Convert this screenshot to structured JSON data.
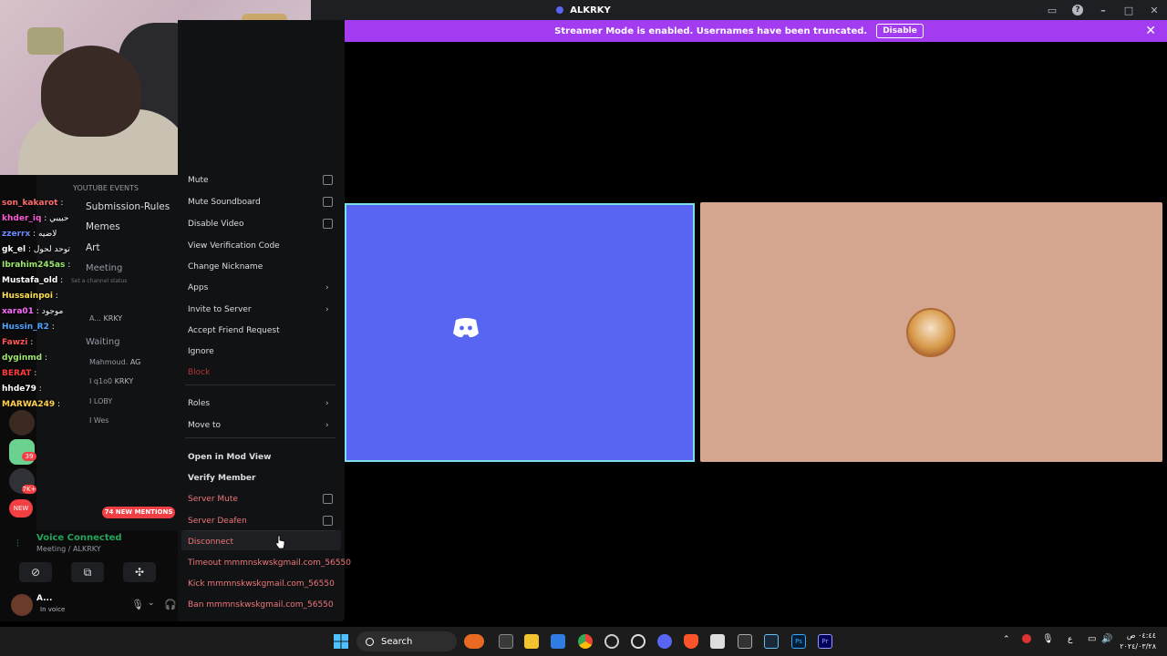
{
  "window": {
    "title": "ALKRKY"
  },
  "banner": {
    "text": "Streamer Mode is enabled. Usernames have been truncated.",
    "disable_label": "Disable"
  },
  "channels": {
    "category": "YOUTUBE EVENTS",
    "items": [
      {
        "label": "Submission-Rules"
      },
      {
        "label": "Memes"
      },
      {
        "label": "Art"
      }
    ],
    "voice_channels": [
      {
        "label": "Meeting"
      },
      {
        "label": "Waiting"
      }
    ],
    "channel_status_placeholder": "Set a channel status",
    "members": [
      {
        "name": "A...",
        "tag": "KRKY"
      },
      {
        "name": "Mahmoud.",
        "tag": "AG"
      },
      {
        "name": "I q1o0",
        "tag": "KRKY"
      },
      {
        "name": "I LOBY",
        "tag": ""
      },
      {
        "name": "I Wes",
        "tag": ""
      }
    ]
  },
  "server_badges": {
    "b1": "39",
    "b2": "7K+",
    "new_label": "NEW"
  },
  "mentions_pill": "74 NEW MENTIONS",
  "chat": [
    {
      "user": "son_kakarot",
      "color": "#ff6b6b",
      "msg": ""
    },
    {
      "user": "khder_iq",
      "color": "#ff5ad6",
      "msg": "حبيبي"
    },
    {
      "user": "zzerrx",
      "color": "#6b8cff",
      "msg": "لاضيه"
    },
    {
      "user": "gk_el",
      "color": "#ffffff",
      "msg": "توحد لحول"
    },
    {
      "user": "Ibrahim245as",
      "color": "#9fe870",
      "msg": ""
    },
    {
      "user": "Mustafa_old",
      "color": "#ffffff",
      "msg": ""
    },
    {
      "user": "Hussainpoi",
      "color": "#ffe14d",
      "msg": ""
    },
    {
      "user": "xara01",
      "color": "#ff6bff",
      "msg": "موجود"
    },
    {
      "user": "Hussin_R2",
      "color": "#4da3ff",
      "msg": ""
    },
    {
      "user": "Fawzi",
      "color": "#ff5555",
      "msg": ""
    },
    {
      "user": "dyginmd",
      "color": "#9fe870",
      "msg": ""
    },
    {
      "user": "BERAT",
      "color": "#ff3b3b",
      "msg": ""
    },
    {
      "user": "hhde79",
      "color": "#ffffff",
      "msg": ""
    },
    {
      "user": "MARWA249",
      "color": "#ffd24d",
      "msg": ""
    }
  ],
  "context_menu": {
    "items": [
      {
        "label": "Mute",
        "kind": "checkbox"
      },
      {
        "label": "Mute Soundboard",
        "kind": "checkbox"
      },
      {
        "label": "Disable Video",
        "kind": "checkbox"
      },
      {
        "label": "View Verification Code",
        "kind": "plain"
      },
      {
        "label": "Change Nickname",
        "kind": "plain"
      },
      {
        "label": "Apps",
        "kind": "submenu"
      },
      {
        "label": "Invite to Server",
        "kind": "submenu"
      },
      {
        "label": "Accept Friend Request",
        "kind": "plain"
      },
      {
        "label": "Ignore",
        "kind": "plain"
      },
      {
        "label": "Block",
        "kind": "danger"
      },
      {
        "label": "Roles",
        "kind": "submenu"
      },
      {
        "label": "Move to",
        "kind": "submenu"
      },
      {
        "label": "Open in Mod View",
        "kind": "bold"
      },
      {
        "label": "Verify Member",
        "kind": "bold"
      },
      {
        "label": "Server Mute",
        "kind": "danger-checkbox"
      },
      {
        "label": "Server Deafen",
        "kind": "danger-checkbox"
      },
      {
        "label": "Disconnect",
        "kind": "danger"
      },
      {
        "label": "Timeout mmmnskwskgmail.com_56550",
        "kind": "danger"
      },
      {
        "label": "Kick mmmnskwskgmail.com_56550",
        "kind": "danger"
      },
      {
        "label": "Ban mmmnskwskgmail.com_56550",
        "kind": "danger"
      }
    ]
  },
  "voice": {
    "status": "Voice Connected",
    "location": "Meeting / ALKRKY"
  },
  "user_panel": {
    "name": "A...",
    "status": "In voice"
  },
  "taskbar": {
    "search_label": "Search",
    "time": "٠٤:٤٤ ص",
    "date": "٢٠٢٤/٠٣/٢٨",
    "lang": "ع"
  },
  "colors": {
    "blurple": "#5865f2",
    "banner": "#a33cf0",
    "danger": "#f0767a",
    "voice_green": "#23a55a",
    "peach_tile": "#d5a68f"
  }
}
